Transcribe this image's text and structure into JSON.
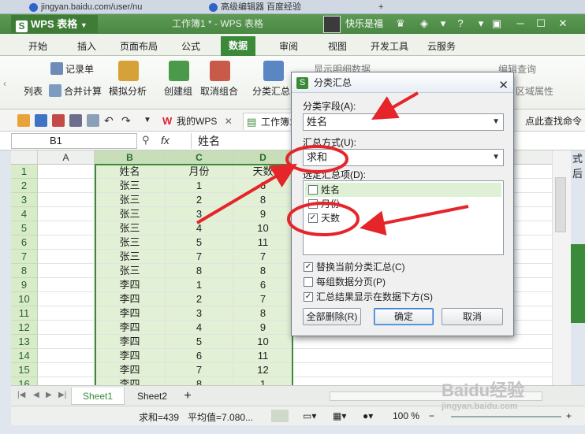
{
  "browser": {
    "tabs": [
      {
        "label": "jingyan.baidu.com/user/nu"
      },
      {
        "label": "高级编辑器 百度经验"
      }
    ],
    "new_tab": "+"
  },
  "titlebar": {
    "app_name": "WPS 表格",
    "doc_title": "工作簿1 * - WPS 表格",
    "user_name": "快乐是福"
  },
  "ribbon_tabs": [
    "开始",
    "插入",
    "页面布局",
    "公式",
    "数据",
    "审阅",
    "视图",
    "开发工具",
    "云服务"
  ],
  "ribbon_active": "数据",
  "ribbon": {
    "record_sheet": "记录单",
    "list": "列表",
    "consolidate": "合并计算",
    "simulate": "模拟分析",
    "group": "创建组",
    "ungroup": "取消组合",
    "subtotal": "分类汇总",
    "show_detail": "显示明细数据",
    "edit_query": "编辑查询",
    "area_props": "区域属性"
  },
  "quickbar": {
    "doc_tabs": [
      "我的WPS",
      "工作簿1"
    ],
    "right_text": "点此查找命令"
  },
  "formula_bar": {
    "cell_ref": "B1",
    "fx": "fx",
    "content": "姓名"
  },
  "sheet": {
    "columns": [
      "A",
      "B",
      "C",
      "D"
    ],
    "rows": [
      {
        "n": "1",
        "b": "姓名",
        "c": "月份",
        "d": "天数"
      },
      {
        "n": "2",
        "b": "张三",
        "c": "1",
        "d": "6"
      },
      {
        "n": "3",
        "b": "张三",
        "c": "2",
        "d": "8"
      },
      {
        "n": "4",
        "b": "张三",
        "c": "3",
        "d": "9"
      },
      {
        "n": "5",
        "b": "张三",
        "c": "4",
        "d": "10"
      },
      {
        "n": "6",
        "b": "张三",
        "c": "5",
        "d": "11"
      },
      {
        "n": "7",
        "b": "张三",
        "c": "7",
        "d": "7"
      },
      {
        "n": "8",
        "b": "张三",
        "c": "8",
        "d": "8"
      },
      {
        "n": "9",
        "b": "李四",
        "c": "1",
        "d": "6"
      },
      {
        "n": "10",
        "b": "李四",
        "c": "2",
        "d": "7"
      },
      {
        "n": "11",
        "b": "李四",
        "c": "3",
        "d": "8"
      },
      {
        "n": "12",
        "b": "李四",
        "c": "4",
        "d": "9"
      },
      {
        "n": "13",
        "b": "李四",
        "c": "5",
        "d": "10"
      },
      {
        "n": "14",
        "b": "李四",
        "c": "6",
        "d": "11"
      },
      {
        "n": "15",
        "b": "李四",
        "c": "7",
        "d": "12"
      },
      {
        "n": "16",
        "b": "李四",
        "c": "8",
        "d": "1"
      }
    ],
    "right_edge_text": "式后"
  },
  "sheet_tabs": [
    "Sheet1",
    "Sheet2"
  ],
  "status": {
    "sum": "求和=439",
    "avg": "平均值=7.080...",
    "zoom": "100 %"
  },
  "dialog": {
    "title": "分类汇总",
    "group_by_label": "分类字段(A):",
    "group_by_value": "姓名",
    "func_label": "汇总方式(U):",
    "func_value": "求和",
    "items_label": "选定汇总项(D):",
    "items": [
      {
        "label": "姓名",
        "checked": false
      },
      {
        "label": "月份",
        "checked": false
      },
      {
        "label": "天数",
        "checked": true
      }
    ],
    "opt_replace": "替换当前分类汇总(C)",
    "opt_pagebreak": "每组数据分页(P)",
    "opt_below": "汇总结果显示在数据下方(S)",
    "btn_remove_all": "全部删除(R)",
    "btn_ok": "确定",
    "btn_cancel": "取消"
  },
  "watermark": "Baidu经验",
  "watermark_sub": "jingyan.baidu.com",
  "colors": {
    "wps_green": "#3b8a3a",
    "annotation_red": "#e5252a",
    "selection_fill": "#e2f0d6"
  }
}
